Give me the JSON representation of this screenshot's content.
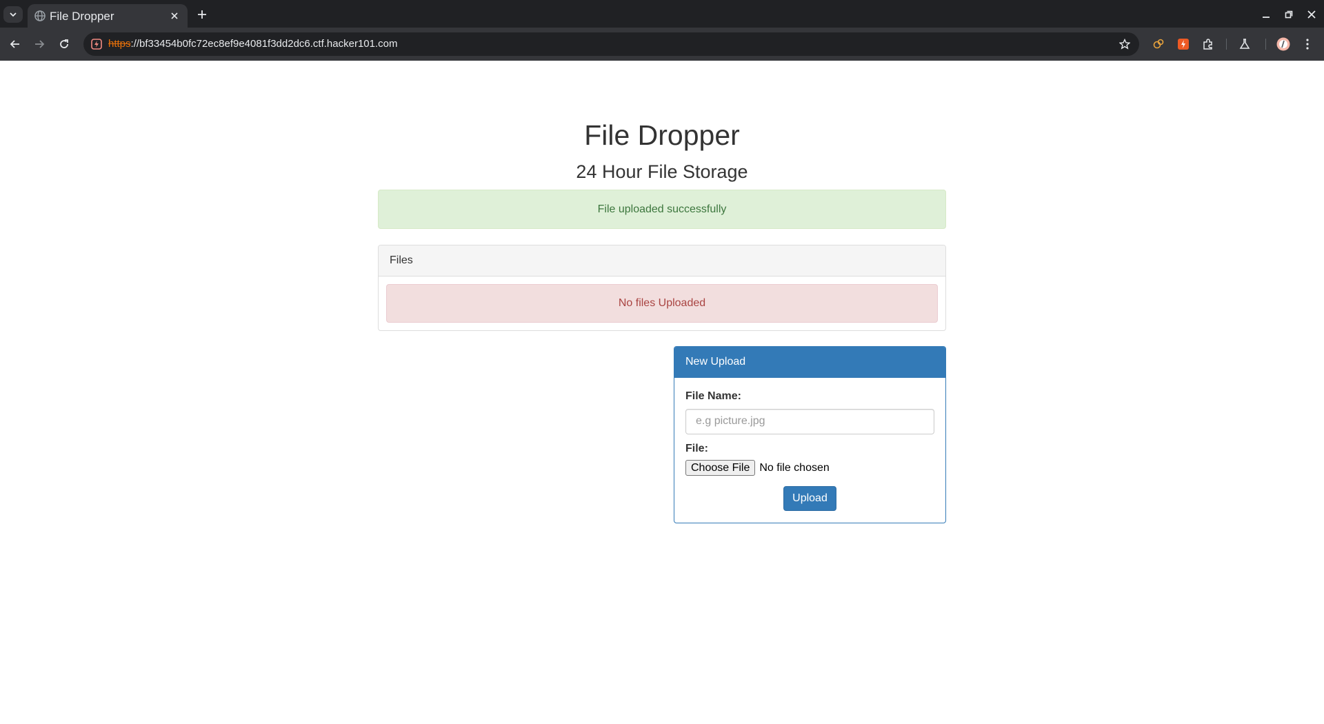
{
  "browser": {
    "tab_title": "File Dropper",
    "url_scheme": "https",
    "url_rest": "://bf33454b0fc72ec8ef9e4081f3dd2dc6.ctf.hacker101.com"
  },
  "page": {
    "title": "File Dropper",
    "subtitle": "24 Hour File Storage",
    "success_message": "File uploaded successfully"
  },
  "files_panel": {
    "heading": "Files",
    "empty_message": "No files Uploaded"
  },
  "upload_panel": {
    "heading": "New Upload",
    "file_name_label": "File Name:",
    "file_name_placeholder": "e.g picture.jpg",
    "file_name_value": "",
    "file_label": "File:",
    "choose_file_label": "Choose File",
    "no_file_text": "No file chosen",
    "upload_label": "Upload"
  },
  "colors": {
    "primary": "#337ab7",
    "success_bg": "#dff0d8",
    "success_text": "#3c763d",
    "danger_bg": "#f2dede",
    "danger_text": "#a94442"
  }
}
